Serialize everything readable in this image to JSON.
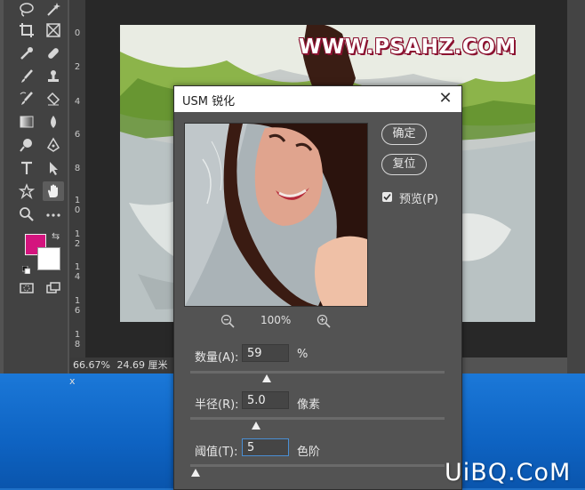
{
  "ruler": [
    "0",
    "2",
    "4",
    "6",
    "8",
    "1",
    "0",
    "1",
    "2",
    "1",
    "4",
    "1",
    "6",
    "1",
    "8"
  ],
  "status": {
    "zoom": "66.67%",
    "size": "24.69 厘米 x"
  },
  "watermark": "WWW.PSAHZ.COM",
  "dialog": {
    "title": "USM 锐化",
    "ok_label": "确定",
    "reset_label": "复位",
    "preview_label": "预览(P)",
    "preview_checked": true,
    "zoom": "100%",
    "params": [
      {
        "label": "数量(A):",
        "value": "59",
        "unit": "%",
        "slider": 0.3
      },
      {
        "label": "半径(R):",
        "value": "5.0",
        "unit": "像素",
        "slider": 0.26
      },
      {
        "label": "阈值(T):",
        "value": "5",
        "unit": "色阶",
        "slider": 0.02
      }
    ]
  },
  "brand": "UiBQ.CoM",
  "colors": {
    "foreground": "#d4147e",
    "background": "#ffffff"
  }
}
